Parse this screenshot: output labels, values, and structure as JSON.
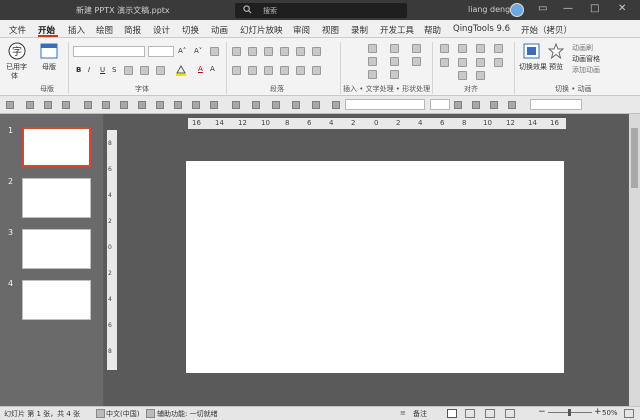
{
  "window": {
    "title": "新建 PPTX 演示文稿.pptx",
    "search_placeholder": "搜索",
    "user_name": "liang deng",
    "btn_minimize": "—",
    "btn_maximize": "□",
    "btn_close": "✕"
  },
  "menu_tabs": [
    "文件",
    "开始",
    "插入",
    "绘图",
    "简报",
    "设计",
    "切换",
    "动画",
    "幻灯片放映",
    "审阅",
    "视图",
    "录制",
    "开发工具",
    "帮助",
    "QingTools 9.6",
    "开始（拷贝）"
  ],
  "ribbon": {
    "clipboard_btn1": "已用字",
    "clipboard_btn1b": "体",
    "clipboard_btn2": "母版",
    "grp_clipboard": "母版",
    "grp_font": "字体",
    "grp_paragraph": "段落",
    "grp_drawing": "插入 • 文字处理 • 形状处理",
    "grp_arrange": "对齐",
    "grp_anim": "切换 • 动画",
    "anim_btn1": "切换效果",
    "anim_btn2": "预览",
    "anim_item1": "动画刷",
    "anim_item2": "动画窗格",
    "anim_item3": "添加动画",
    "font_bold": "B",
    "font_italic": "I",
    "font_underline": "U",
    "font_strike": "S",
    "font_a1": "A",
    "font_a2": "A",
    "font_grow": "A˄",
    "font_shrink": "A˅"
  },
  "slides": [
    {
      "num": "1",
      "selected": true
    },
    {
      "num": "2",
      "selected": false
    },
    {
      "num": "3",
      "selected": false
    },
    {
      "num": "4",
      "selected": false
    }
  ],
  "ruler_h": [
    "16",
    "14",
    "12",
    "10",
    "8",
    "6",
    "4",
    "2",
    "0",
    "2",
    "4",
    "6",
    "8",
    "10",
    "12",
    "14",
    "16"
  ],
  "ruler_v": [
    "8",
    "6",
    "4",
    "2",
    "0",
    "2",
    "4",
    "6",
    "8"
  ],
  "status": {
    "slide_info": "幻灯片 第 1 张，共 4 张",
    "language": "中文(中国)",
    "accessibility": "辅助功能: 一切就绪",
    "notes": "备注",
    "zoom": "50%"
  }
}
